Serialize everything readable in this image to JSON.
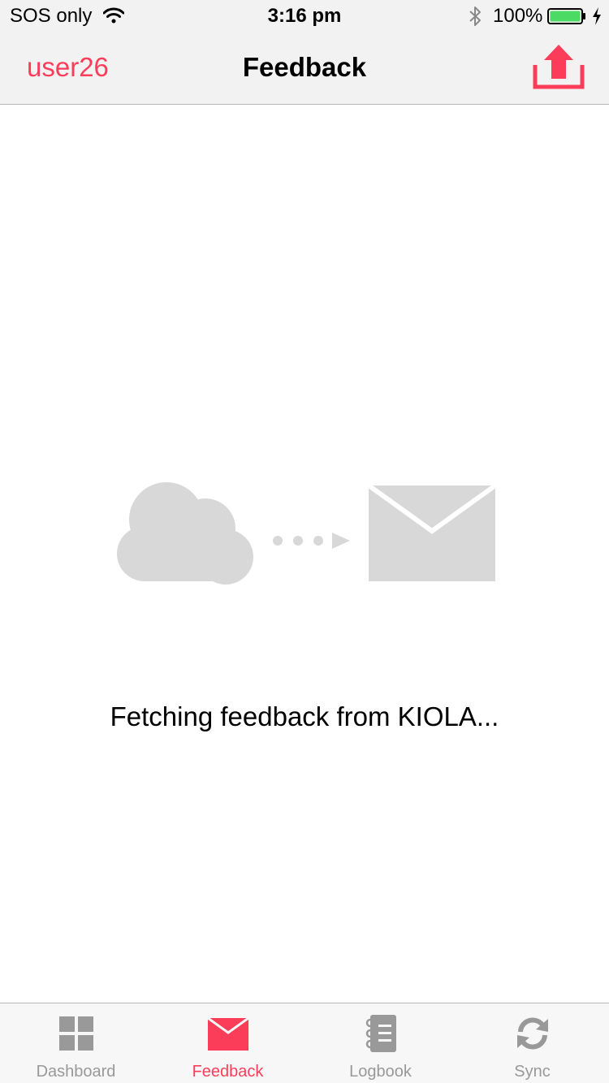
{
  "status_bar": {
    "carrier": "SOS only",
    "time": "3:16 pm",
    "battery_percent": "100%",
    "icons": [
      "wifi-icon",
      "bluetooth-icon",
      "battery-icon",
      "charging-icon"
    ]
  },
  "nav": {
    "left_label": "user26",
    "title": "Feedback",
    "right_icon": "upload-icon"
  },
  "main": {
    "illustration_icons": [
      "cloud-icon",
      "dots-arrow-icon",
      "mail-icon"
    ],
    "message": "Fetching feedback from KIOLA..."
  },
  "tabs": [
    {
      "label": "Dashboard",
      "icon": "grid-icon",
      "active": false
    },
    {
      "label": "Feedback",
      "icon": "mail-icon",
      "active": true
    },
    {
      "label": "Logbook",
      "icon": "notebook-icon",
      "active": false
    },
    {
      "label": "Sync",
      "icon": "sync-icon",
      "active": false
    }
  ],
  "colors": {
    "accent": "#fc3d5a",
    "bar_background": "#f2f2f2",
    "tab_inactive": "#999999",
    "illustration_gray": "#d8d8d8",
    "battery_green": "#4cd964"
  }
}
